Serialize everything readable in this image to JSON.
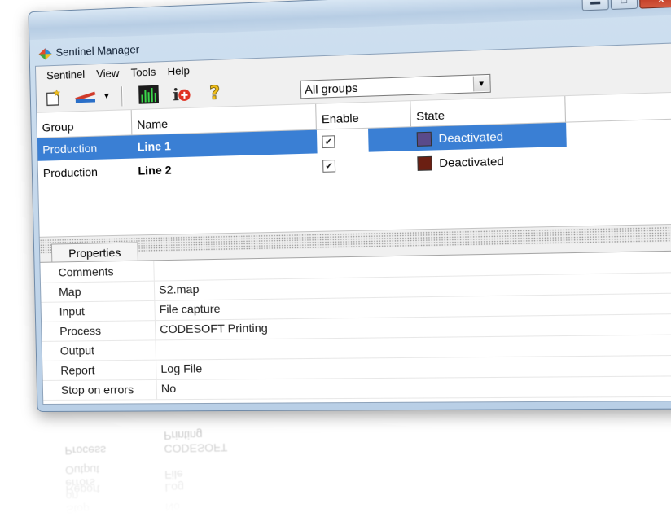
{
  "window": {
    "title": "Sentinel Manager",
    "controls": [
      "minimize-icon",
      "maximize-icon",
      "close-icon"
    ],
    "close_glyph": "x"
  },
  "menu": [
    "Sentinel",
    "View",
    "Tools",
    "Help"
  ],
  "toolbar": {
    "buttons": [
      "new-document-icon",
      "route-icon",
      "dropdown-arrow-icon",
      "monitor-chart-icon",
      "info-add-icon",
      "help-icon"
    ],
    "group_filter": {
      "value": "All groups"
    }
  },
  "grid": {
    "columns": [
      "Group",
      "Name",
      "Enable",
      "State"
    ],
    "rows": [
      {
        "group": "Production",
        "name": "Line 1",
        "enabled": true,
        "state": "Deactivated",
        "state_color": "#5a4a8a",
        "selected": true
      },
      {
        "group": "Production",
        "name": "Line 2",
        "enabled": true,
        "state": "Deactivated",
        "state_color": "#6b1f12",
        "selected": false
      }
    ]
  },
  "properties": {
    "tab_label": "Properties",
    "items": [
      {
        "key": "Comments",
        "value": ""
      },
      {
        "key": "Map",
        "value": "S2.map"
      },
      {
        "key": "Input",
        "value": "File capture"
      },
      {
        "key": "Process",
        "value": "CODESOFT Printing"
      },
      {
        "key": "Output",
        "value": ""
      },
      {
        "key": "Report",
        "value": "Log File"
      },
      {
        "key": "Stop on errors",
        "value": "No"
      }
    ]
  },
  "colors": {
    "selection": "#3a7fd4",
    "close_button": "#c6432c"
  }
}
